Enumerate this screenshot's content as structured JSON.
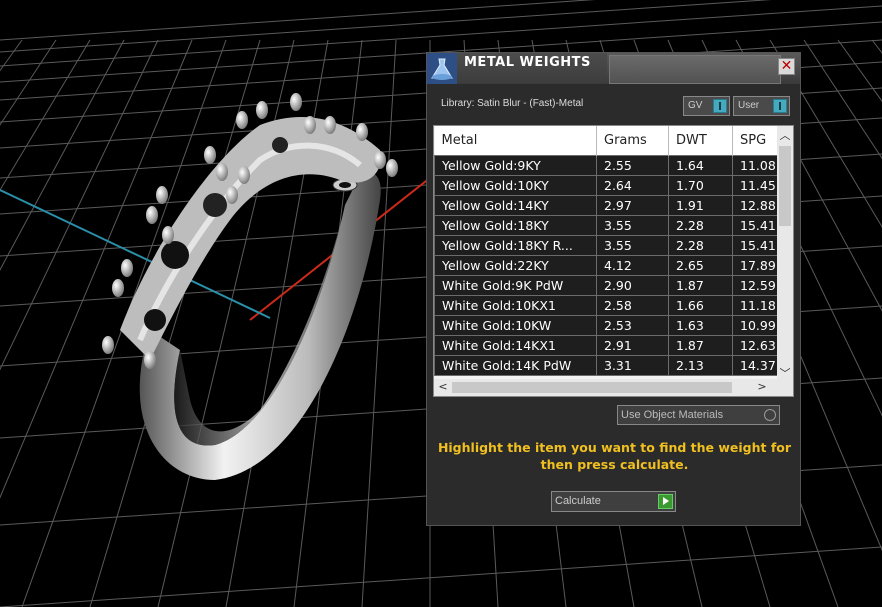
{
  "panel": {
    "title": "METAL WEIGHTS",
    "close_glyph": "✕",
    "library_label": "Library: Satin Blur - (Fast)-Metal",
    "toggles": [
      {
        "label": "GV"
      },
      {
        "label": "User"
      }
    ],
    "columns": [
      "Metal",
      "Grams",
      "DWT",
      "SPG"
    ],
    "rows": [
      [
        "Yellow Gold:9KY",
        "2.55",
        "1.64",
        "11.08"
      ],
      [
        "Yellow Gold:10KY",
        "2.64",
        "1.70",
        "11.45"
      ],
      [
        "Yellow Gold:14KY",
        "2.97",
        "1.91",
        "12.88"
      ],
      [
        "Yellow Gold:18KY",
        "3.55",
        "2.28",
        "15.41"
      ],
      [
        "Yellow Gold:18KY R...",
        "3.55",
        "2.28",
        "15.41"
      ],
      [
        "Yellow Gold:22KY",
        "4.12",
        "2.65",
        "17.89"
      ],
      [
        "White Gold:9K PdW",
        "2.90",
        "1.87",
        "12.59"
      ],
      [
        "White Gold:10KX1",
        "2.58",
        "1.66",
        "11.18"
      ],
      [
        "White Gold:10KW",
        "2.53",
        "1.63",
        "10.99"
      ],
      [
        "White Gold:14KX1",
        "2.91",
        "1.87",
        "12.63"
      ],
      [
        "White Gold:14K PdW",
        "3.31",
        "2.13",
        "14.37"
      ]
    ],
    "dropdown_label": "Use Object Materials",
    "instruction": "Highlight the item you want to find the weight for then press calculate.",
    "calculate_label": "Calculate"
  },
  "colors": {
    "instruction": "#f0c020",
    "x_axis": "#cc2a1a",
    "z_axis": "#2a8fa8",
    "toggle_knob": "#44aac0",
    "go_button": "#3a9a30"
  }
}
